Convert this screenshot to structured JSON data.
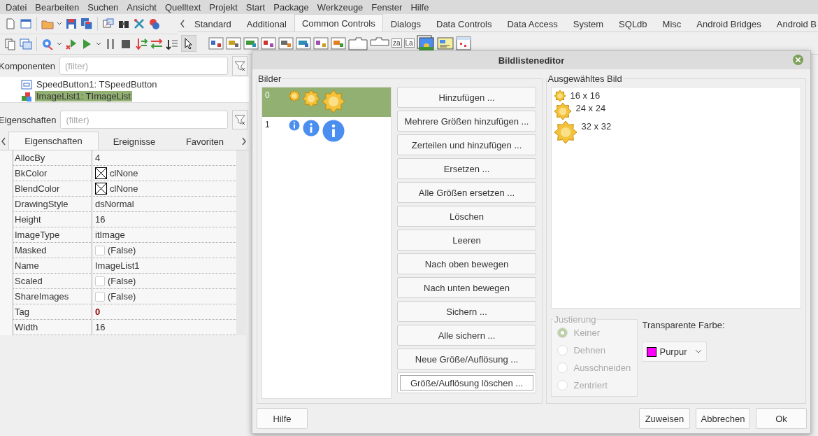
{
  "menu": [
    "Datei",
    "Bearbeiten",
    "Suchen",
    "Ansicht",
    "Quelltext",
    "Projekt",
    "Start",
    "Package",
    "Werkzeuge",
    "Fenster",
    "Hilfe"
  ],
  "palette_tabs": [
    {
      "label": "Standard",
      "selected": false
    },
    {
      "label": "Additional",
      "selected": false
    },
    {
      "label": "Common Controls",
      "selected": true
    },
    {
      "label": "Dialogs",
      "selected": false
    },
    {
      "label": "Data Controls",
      "selected": false
    },
    {
      "label": "Data Access",
      "selected": false
    },
    {
      "label": "System",
      "selected": false
    },
    {
      "label": "SQLdb",
      "selected": false
    },
    {
      "label": "Misc",
      "selected": false
    },
    {
      "label": "Android Bridges",
      "selected": false
    },
    {
      "label": "Android B",
      "selected": false
    }
  ],
  "palette_icons": [
    "za",
    "La"
  ],
  "components": {
    "label": "Komponenten",
    "placeholder": "(filter)",
    "tree": [
      {
        "label": "SpeedButton1: TSpeedButton",
        "kind": "button",
        "selected": false
      },
      {
        "label": "ImageList1: TImageList",
        "kind": "imagelist",
        "selected": true
      }
    ]
  },
  "properties": {
    "label": "Eigenschaften",
    "placeholder": "(filter)",
    "tabs": [
      {
        "label": "Eigenschaften",
        "selected": true
      },
      {
        "label": "Ereignisse",
        "selected": false
      },
      {
        "label": "Favoriten",
        "selected": false
      }
    ],
    "rows": [
      {
        "name": "AllocBy",
        "kind": "text",
        "value": "4",
        "modified": false
      },
      {
        "name": "BkColor",
        "kind": "color",
        "value": "clNone",
        "modified": false
      },
      {
        "name": "BlendColor",
        "kind": "color",
        "value": "clNone",
        "modified": false
      },
      {
        "name": "DrawingStyle",
        "kind": "text",
        "value": "dsNormal",
        "modified": false
      },
      {
        "name": "Height",
        "kind": "text",
        "value": "16",
        "modified": false
      },
      {
        "name": "ImageType",
        "kind": "text",
        "value": "itImage",
        "modified": false
      },
      {
        "name": "Masked",
        "kind": "bool",
        "value": "(False)",
        "checked": false,
        "modified": false
      },
      {
        "name": "Name",
        "kind": "text",
        "value": "ImageList1",
        "modified": false
      },
      {
        "name": "Scaled",
        "kind": "bool",
        "value": "(False)",
        "checked": false,
        "modified": false
      },
      {
        "name": "ShareImages",
        "kind": "bool",
        "value": "(False)",
        "checked": false,
        "modified": false
      },
      {
        "name": "Tag",
        "kind": "text",
        "value": "0",
        "modified": true
      },
      {
        "name": "Width",
        "kind": "text",
        "value": "16",
        "modified": false
      }
    ]
  },
  "dialog": {
    "title": "Bildlisteneditor",
    "images": {
      "title": "Bilder",
      "items": [
        {
          "index": "0",
          "kind": "badge",
          "selected": true
        },
        {
          "index": "1",
          "kind": "info",
          "selected": false
        }
      ]
    },
    "buttons": [
      {
        "label": "Hinzufügen ...",
        "focused": false
      },
      {
        "label": "Mehrere Größen hinzufügen ...",
        "focused": false
      },
      {
        "label": "Zerteilen und hinzufügen ...",
        "focused": false
      },
      {
        "label": "Ersetzen ...",
        "focused": false
      },
      {
        "label": "Alle Größen ersetzen ...",
        "focused": false
      },
      {
        "label": "Löschen",
        "focused": false
      },
      {
        "label": "Leeren",
        "focused": false
      },
      {
        "label": "Nach oben bewegen",
        "focused": false
      },
      {
        "label": "Nach unten bewegen",
        "focused": false
      },
      {
        "label": "Sichern ...",
        "focused": false
      },
      {
        "label": "Alle sichern ...",
        "focused": false
      },
      {
        "label": "Neue Größe/Auflösung ...",
        "focused": false
      },
      {
        "label": "Größe/Auflösung löschen ...",
        "focused": true
      }
    ],
    "selected_image": {
      "title": "Ausgewähltes Bild",
      "sizes": [
        "16 x 16",
        "24 x 24",
        "32 x 32"
      ]
    },
    "justification": {
      "title": "Justierung",
      "disabled": true,
      "options": [
        {
          "label": "Keiner",
          "selected": true
        },
        {
          "label": "Dehnen",
          "selected": false
        },
        {
          "label": "Ausschneiden",
          "selected": false
        },
        {
          "label": "Zentriert",
          "selected": false
        }
      ]
    },
    "transparent_color": {
      "label": "Transparente Farbe:",
      "value": "Purpur",
      "color": "#ff00ff"
    },
    "help": "Hilfe",
    "footer_buttons": [
      "Zuweisen",
      "Abbrechen",
      "Ok"
    ]
  }
}
